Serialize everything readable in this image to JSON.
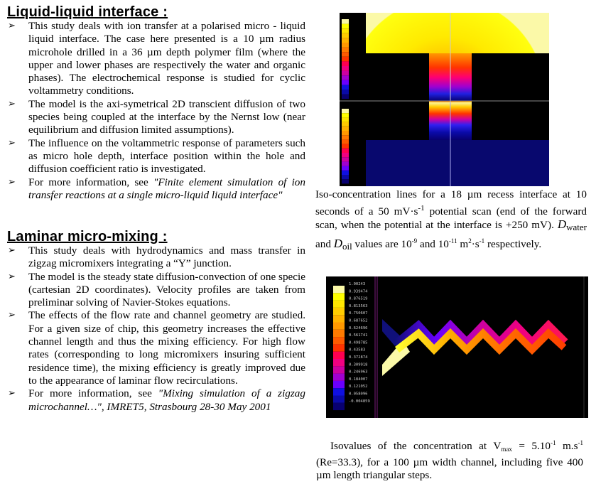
{
  "sections": [
    {
      "title": "Liquid-liquid interface :",
      "bullets": [
        "This study deals with ion transfer at a polarised micro - liquid liquid interface. The case here presented is a 10 µm radius microhole drilled in a 36 µm depth polymer film (where the upper and lower phases are respectively the water and organic phases). The electrochemical response is studied for cyclic voltammetry conditions.",
        "The model is the axi-symetrical 2D transcient diffusion of two species being coupled at the interface by the Nernst low (near equilibrium and diffusion limited assumptions).",
        "The influence on the voltammetric response of parameters such as micro hole depth, interface position within the hole and diffusion coefficient ratio is investigated."
      ],
      "reference": {
        "prefix": "For more information, see ",
        "title": "\"Finite element simulation of ion transfer reactions at a single micro-liquid  liquid interface\"",
        "suffix": ""
      }
    },
    {
      "title": "Laminar micro-mixing :",
      "bullets": [
        "This study deals with  hydrodynamics and mass transfer in zigzag micromixers integrating a “Y” junction.",
        "The model is the steady state diffusion-convection of one specie (cartesian 2D coordinates). Velocity profiles are taken from preliminar solving of Navier-Stokes equations.",
        "The effects of the flow rate and channel geometry are studied. For a given size of chip, this geometry increases the effective channel length and thus the mixing efficiency. For high flow rates (corresponding to long micromixers insuring sufficient residence time), the mixing efficiency is greatly improved due to the appearance of laminar flow recirculations."
      ],
      "reference": {
        "prefix": "For more information, see ",
        "title": "\"Mixing simulation of a zigzag microchannel…\", IMRET5, Strasbourg 28-30 May 2001",
        "suffix": ""
      }
    }
  ],
  "bullet_icon": "➢",
  "caption1": {
    "line1": "Iso-concentration lines for a 18 µm recess interface at 10 seconds of a 50 mV·s",
    "exp1": "-1",
    "line2": " potential scan (end of the forward scan, when the potential at the interface is +250 mV). ",
    "d1": "D",
    "d1_sub": "water",
    "and": " and ",
    "d2": "D",
    "d2_sub": "oil",
    "values": " values are 10",
    "exp2": "-9",
    "and2": " and 10",
    "exp3": "-11",
    "unit": " m",
    "exp4": "2",
    "unit2": "·s",
    "exp5": "-1",
    "end": " respectively."
  },
  "caption2": {
    "start": "Isovalues of the concentration at V",
    "sub": "max",
    "eq": " = 5.10",
    "exp1": "-1",
    "unit": " m.s",
    "exp2": "-1",
    "rest": " (Re=33.3), for a 100 µm width channel, including  five 400 µm length triangular steps."
  },
  "legend_zigzag": [
    "1.00243",
    "0.939474",
    "0.876519",
    "0.813563",
    "0.750607",
    "0.687652",
    "0.624696",
    "0.561741",
    "0.498785",
    "0.43583",
    "0.372874",
    "0.309918",
    "0.246963",
    "0.184007",
    "0.121052",
    "0.058096",
    "-0.004859"
  ],
  "colormap": [
    "#fbf9a8",
    "#ffff00",
    "#ffe600",
    "#ffcc00",
    "#ffb300",
    "#ff9900",
    "#ff7a00",
    "#ff5a00",
    "#ff3300",
    "#ff0050",
    "#f00080",
    "#cc00a0",
    "#a000d0",
    "#6a00ff",
    "#1010e0",
    "#0a0aa8",
    "#080070"
  ]
}
